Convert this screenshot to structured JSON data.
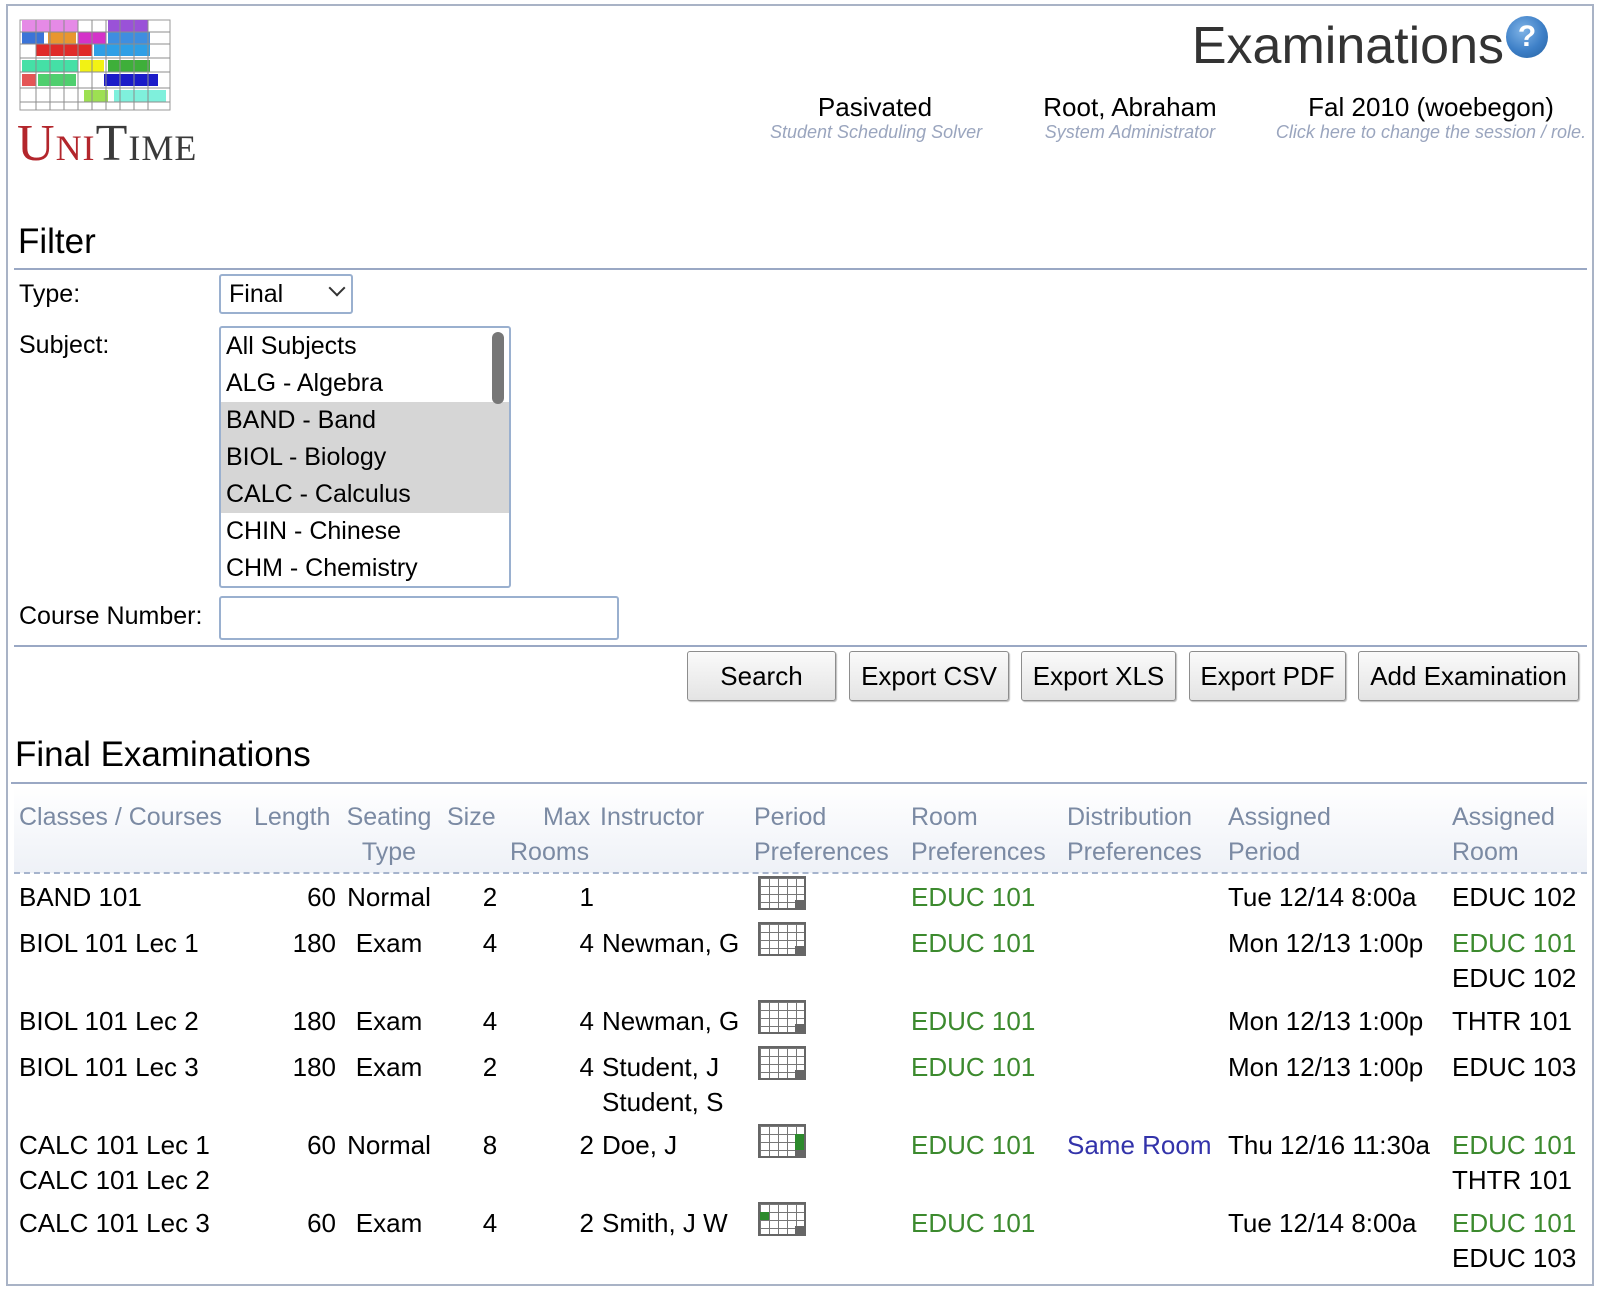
{
  "header": {
    "logo_text_u": "U",
    "logo_text_ni": "NI",
    "logo_text_t": "T",
    "logo_text_ime": "IME",
    "title": "Examinations",
    "help_symbol": "?",
    "solver": {
      "main": "Pasivated",
      "sub": "Student Scheduling Solver"
    },
    "user": {
      "main": "Root, Abraham",
      "sub": "System Administrator"
    },
    "session": {
      "main": "Fal 2010 (woebegon)",
      "sub": "Click here to change the session / role."
    }
  },
  "filter": {
    "title": "Filter",
    "type_label": "Type:",
    "type_value": "Final",
    "subject_label": "Subject:",
    "subjects": [
      {
        "label": "All Subjects",
        "selected": false
      },
      {
        "label": "ALG - Algebra",
        "selected": false
      },
      {
        "label": "BAND - Band",
        "selected": true
      },
      {
        "label": "BIOL - Biology",
        "selected": true
      },
      {
        "label": "CALC - Calculus",
        "selected": true
      },
      {
        "label": "CHIN - Chinese",
        "selected": false
      },
      {
        "label": "CHM - Chemistry",
        "selected": false
      }
    ],
    "course_number_label": "Course Number:",
    "course_number_value": ""
  },
  "buttons": {
    "search": "Search",
    "export_csv": "Export CSV",
    "export_xls": "Export XLS",
    "export_pdf": "Export PDF",
    "add_examination": "Add Examination"
  },
  "results": {
    "title": "Final Examinations",
    "headers": {
      "classes": "Classes / Courses",
      "length": "Length",
      "seating_1": "Seating",
      "seating_2": "Type",
      "size": "Size",
      "max_1": "Max",
      "max_2": "Rooms",
      "instructor": "Instructor",
      "period_pref_1": "Period",
      "period_pref_2": "Preferences",
      "room_pref_1": "Room",
      "room_pref_2": "Preferences",
      "dist_pref_1": "Distribution",
      "dist_pref_2": "Preferences",
      "assigned_period_1": "Assigned",
      "assigned_period_2": "Period",
      "assigned_room_1": "Assigned",
      "assigned_room_2": "Room"
    },
    "rows": [
      {
        "classes": [
          "BAND 101"
        ],
        "length": "60",
        "seating": "Normal",
        "size": "2",
        "max_rooms": "1",
        "instructors": [],
        "room_pref": "EDUC 101",
        "dist_pref": "",
        "assigned_period": "Tue 12/14 8:00a",
        "assigned_rooms": [
          {
            "name": "EDUC 102",
            "preferred": false
          }
        ],
        "period_mark": "none"
      },
      {
        "classes": [
          "BIOL 101 Lec 1"
        ],
        "length": "180",
        "seating": "Exam",
        "size": "4",
        "max_rooms": "4",
        "instructors": [
          "Newman, G"
        ],
        "room_pref": "EDUC 101",
        "dist_pref": "",
        "assigned_period": "Mon 12/13 1:00p",
        "assigned_rooms": [
          {
            "name": "EDUC 101",
            "preferred": true
          },
          {
            "name": "EDUC 102",
            "preferred": false
          }
        ],
        "period_mark": "none"
      },
      {
        "classes": [
          "BIOL 101 Lec 2"
        ],
        "length": "180",
        "seating": "Exam",
        "size": "4",
        "max_rooms": "4",
        "instructors": [
          "Newman, G"
        ],
        "room_pref": "EDUC 101",
        "dist_pref": "",
        "assigned_period": "Mon 12/13 1:00p",
        "assigned_rooms": [
          {
            "name": "THTR 101",
            "preferred": false
          }
        ],
        "period_mark": "none"
      },
      {
        "classes": [
          "BIOL 101 Lec 3"
        ],
        "length": "180",
        "seating": "Exam",
        "size": "2",
        "max_rooms": "4",
        "instructors": [
          "Student, J",
          "Student, S"
        ],
        "room_pref": "EDUC 101",
        "dist_pref": "",
        "assigned_period": "Mon 12/13 1:00p",
        "assigned_rooms": [
          {
            "name": "EDUC 103",
            "preferred": false
          }
        ],
        "period_mark": "none"
      },
      {
        "classes": [
          "CALC 101 Lec 1",
          "CALC 101 Lec 2"
        ],
        "length": "60",
        "seating": "Normal",
        "size": "8",
        "max_rooms": "2",
        "instructors": [
          "Doe, J"
        ],
        "room_pref": "EDUC 101",
        "dist_pref": "Same Room",
        "assigned_period": "Thu 12/16 11:30a",
        "assigned_rooms": [
          {
            "name": "EDUC 101",
            "preferred": true
          },
          {
            "name": "THTR 101",
            "preferred": false
          }
        ],
        "period_mark": "right"
      },
      {
        "classes": [
          "CALC 101 Lec 3"
        ],
        "length": "60",
        "seating": "Exam",
        "size": "4",
        "max_rooms": "2",
        "instructors": [
          "Smith, J W"
        ],
        "room_pref": "EDUC 101",
        "dist_pref": "",
        "assigned_period": "Tue 12/14 8:00a",
        "assigned_rooms": [
          {
            "name": "EDUC 101",
            "preferred": true
          },
          {
            "name": "EDUC 103",
            "preferred": false
          }
        ],
        "period_mark": "left"
      }
    ]
  }
}
